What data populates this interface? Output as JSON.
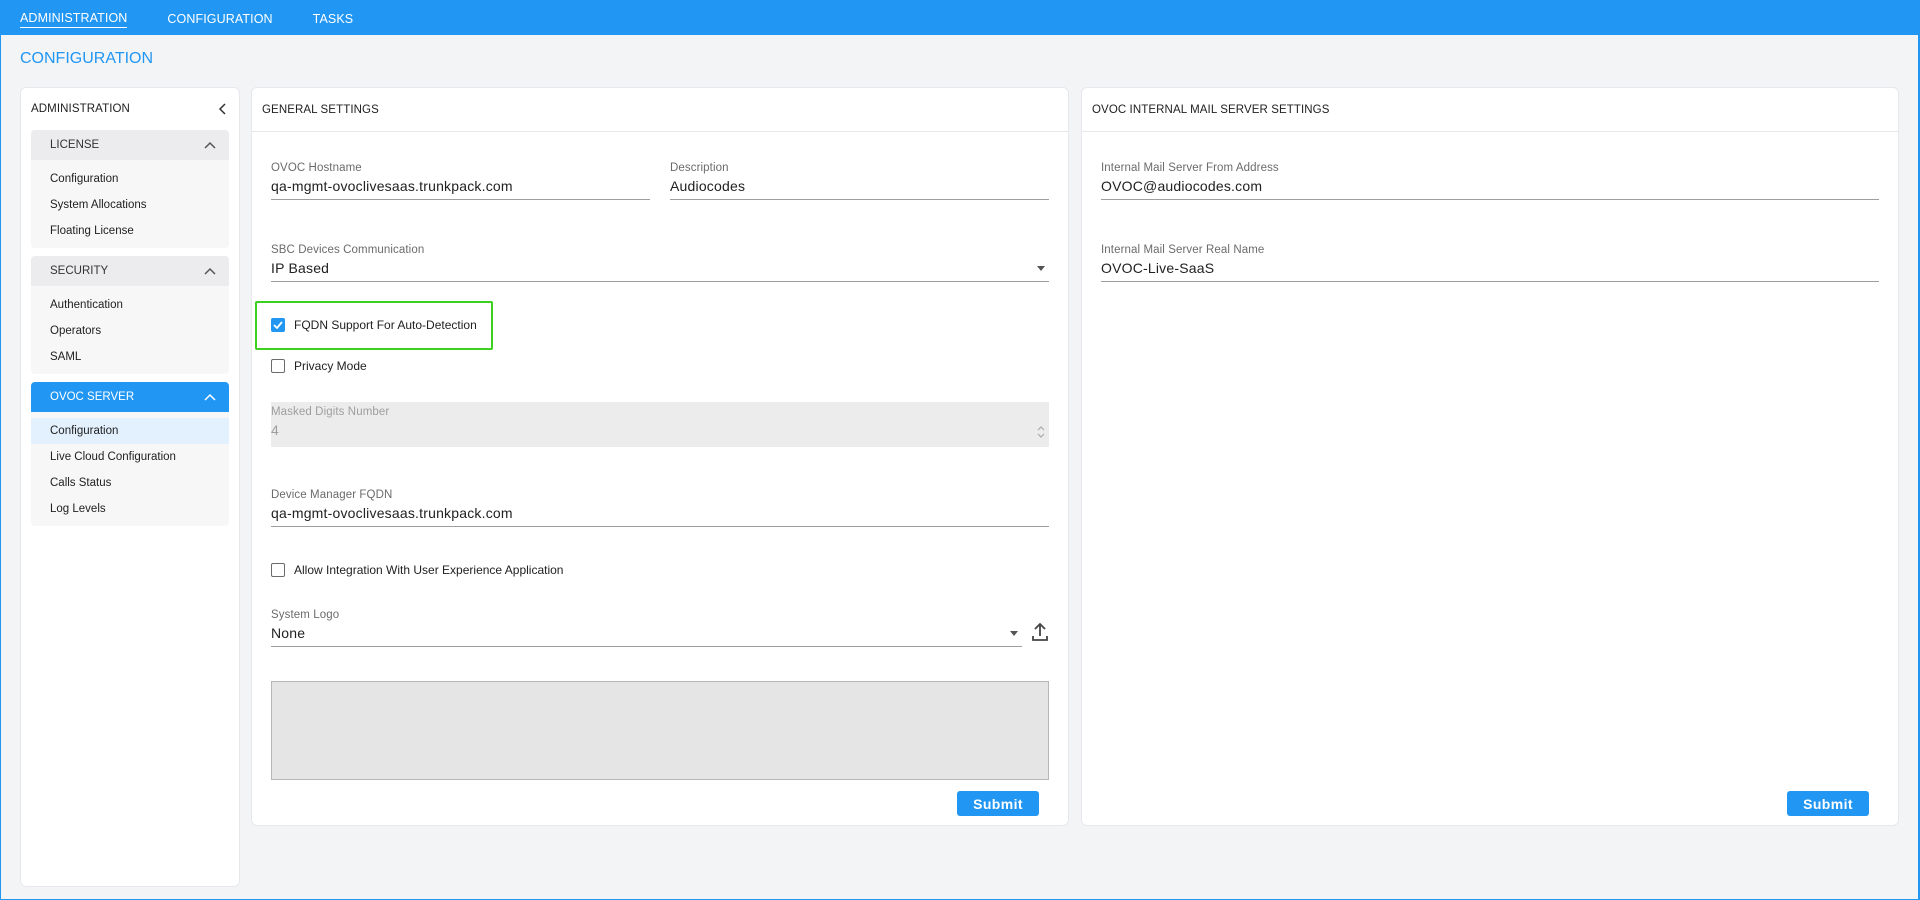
{
  "topnav": {
    "items": [
      {
        "label": "ADMINISTRATION",
        "active": true
      },
      {
        "label": "CONFIGURATION",
        "active": false
      },
      {
        "label": "TASKS",
        "active": false
      }
    ]
  },
  "page_title": "CONFIGURATION",
  "sidebar": {
    "title": "ADMINISTRATION",
    "groups": [
      {
        "label": "LICENSE",
        "items": [
          "Configuration",
          "System Allocations",
          "Floating License"
        ]
      },
      {
        "label": "SECURITY",
        "items": [
          "Authentication",
          "Operators",
          "SAML"
        ]
      },
      {
        "label": "OVOC SERVER",
        "items": [
          "Configuration",
          "Live Cloud Configuration",
          "Calls Status",
          "Log Levels"
        ]
      }
    ]
  },
  "general": {
    "title": "GENERAL SETTINGS",
    "hostname": {
      "label": "OVOC Hostname",
      "value": "qa-mgmt-ovoclivesaas.trunkpack.com"
    },
    "description": {
      "label": "Description",
      "value": "Audiocodes"
    },
    "sbc": {
      "label": "SBC Devices Communication",
      "value": "IP Based"
    },
    "fqdn_support": {
      "label": "FQDN Support For Auto-Detection",
      "checked": true
    },
    "privacy_mode": {
      "label": "Privacy Mode",
      "checked": false
    },
    "masked_digits": {
      "label": "Masked Digits Number",
      "value": "4"
    },
    "device_manager_fqdn": {
      "label": "Device Manager FQDN",
      "value": "qa-mgmt-ovoclivesaas.trunkpack.com"
    },
    "allow_integration": {
      "label": "Allow Integration With User Experience Application",
      "checked": false
    },
    "system_logo": {
      "label": "System Logo",
      "value": "None"
    },
    "submit_label": "Submit"
  },
  "mail": {
    "title": "OVOC INTERNAL MAIL SERVER SETTINGS",
    "from_address": {
      "label": "Internal Mail Server From Address",
      "value": "OVOC@audiocodes.com"
    },
    "real_name": {
      "label": "Internal Mail Server Real Name",
      "value": "OVOC-Live-SaaS"
    },
    "submit_label": "Submit"
  },
  "colors": {
    "accent": "#2196f3",
    "highlight": "#3dd11f"
  }
}
